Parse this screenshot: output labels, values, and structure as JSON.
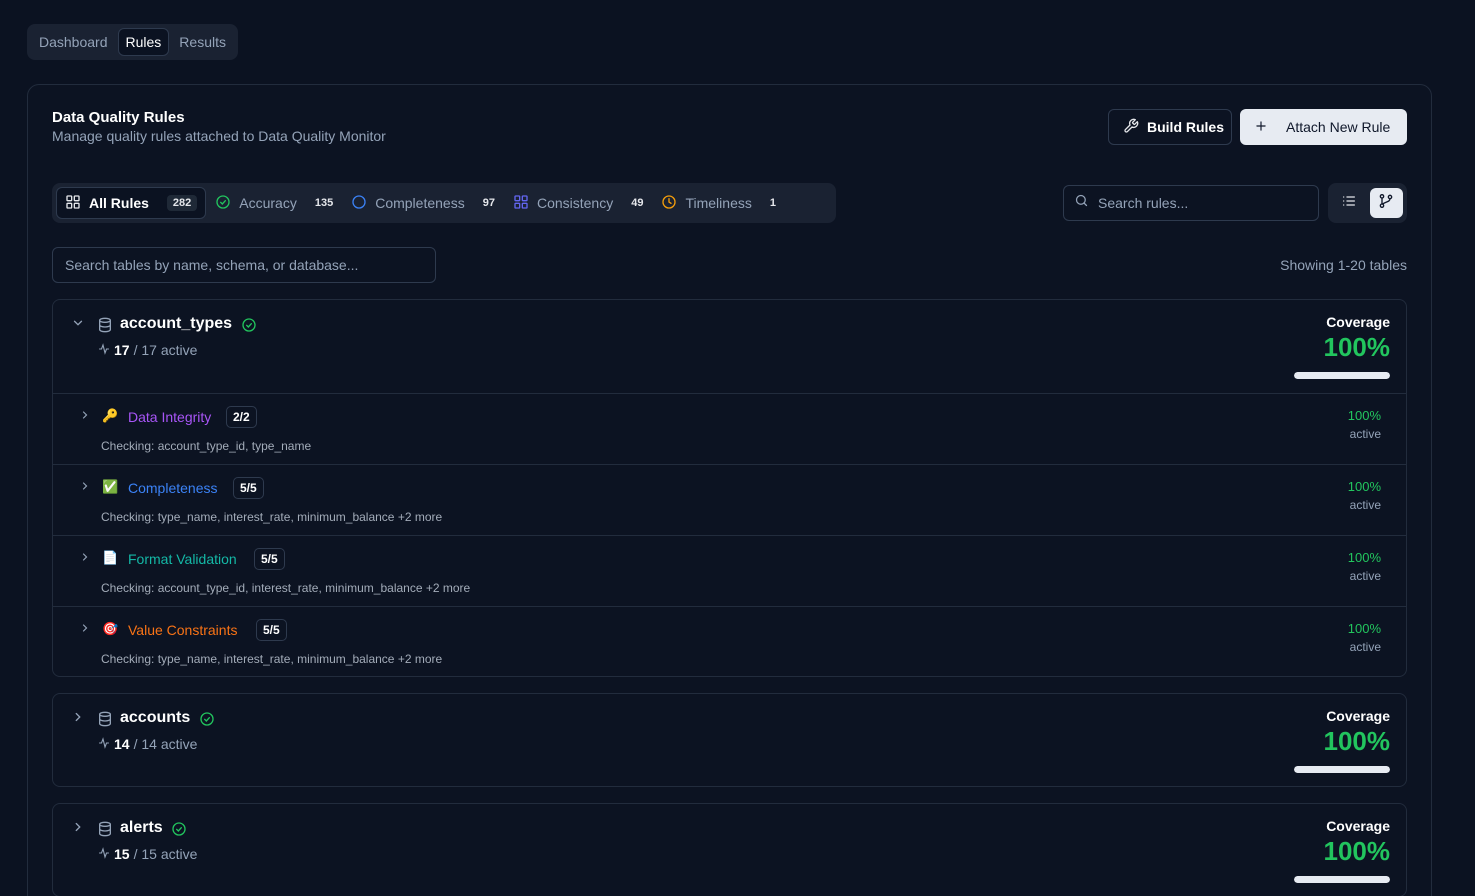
{
  "nav": {
    "tabs": [
      "Dashboard",
      "Rules",
      "Results"
    ],
    "active": "Rules"
  },
  "header": {
    "title": "Data Quality Rules",
    "subtitle": "Manage quality rules attached to Data Quality Monitor",
    "build_label": "Build Rules",
    "attach_label": "Attach New Rule"
  },
  "categories": [
    {
      "label": "All Rules",
      "count": "282",
      "icon": "grid-icon"
    },
    {
      "label": "Accuracy",
      "count": "135",
      "icon": "check-circle-icon",
      "color": "#22c55e"
    },
    {
      "label": "Completeness",
      "count": "97",
      "icon": "circle-icon",
      "color": "#3b82f6"
    },
    {
      "label": "Consistency",
      "count": "49",
      "icon": "grid-icon",
      "color": "#6366f1"
    },
    {
      "label": "Timeliness",
      "count": "1",
      "icon": "clock-icon",
      "color": "#f59e0b"
    }
  ],
  "search": {
    "rules_placeholder": "Search rules...",
    "tables_placeholder": "Search tables by name, schema, or database..."
  },
  "showing": "Showing 1-20 tables",
  "coverage_label": "Coverage",
  "tables": [
    {
      "name": "account_types",
      "active_count": "17",
      "active_total": "/ 17 active",
      "coverage": "100%",
      "coverage_fraction": 1.0,
      "expanded": true,
      "rules": [
        {
          "name": "Data Integrity",
          "emoji": "🔑",
          "color": "#a855f7",
          "badge": "2/2",
          "checking": "Checking: account_type_id, type_name",
          "pct": "100%",
          "status": "active"
        },
        {
          "name": "Completeness",
          "emoji": "✅",
          "color": "#3b82f6",
          "badge": "5/5",
          "checking": "Checking: type_name, interest_rate, minimum_balance +2 more",
          "pct": "100%",
          "status": "active"
        },
        {
          "name": "Format Validation",
          "emoji": "📄",
          "color": "#14b8a6",
          "badge": "5/5",
          "checking": "Checking: account_type_id, interest_rate, minimum_balance +2 more",
          "pct": "100%",
          "status": "active"
        },
        {
          "name": "Value Constraints",
          "emoji": "🎯",
          "color": "#f97316",
          "badge": "5/5",
          "checking": "Checking: type_name, interest_rate, minimum_balance +2 more",
          "pct": "100%",
          "status": "active"
        }
      ]
    },
    {
      "name": "accounts",
      "active_count": "14",
      "active_total": "/ 14 active",
      "coverage": "100%",
      "coverage_fraction": 1.0,
      "expanded": false
    },
    {
      "name": "alerts",
      "active_count": "15",
      "active_total": "/ 15 active",
      "coverage": "100%",
      "coverage_fraction": 1.0,
      "expanded": false
    }
  ]
}
